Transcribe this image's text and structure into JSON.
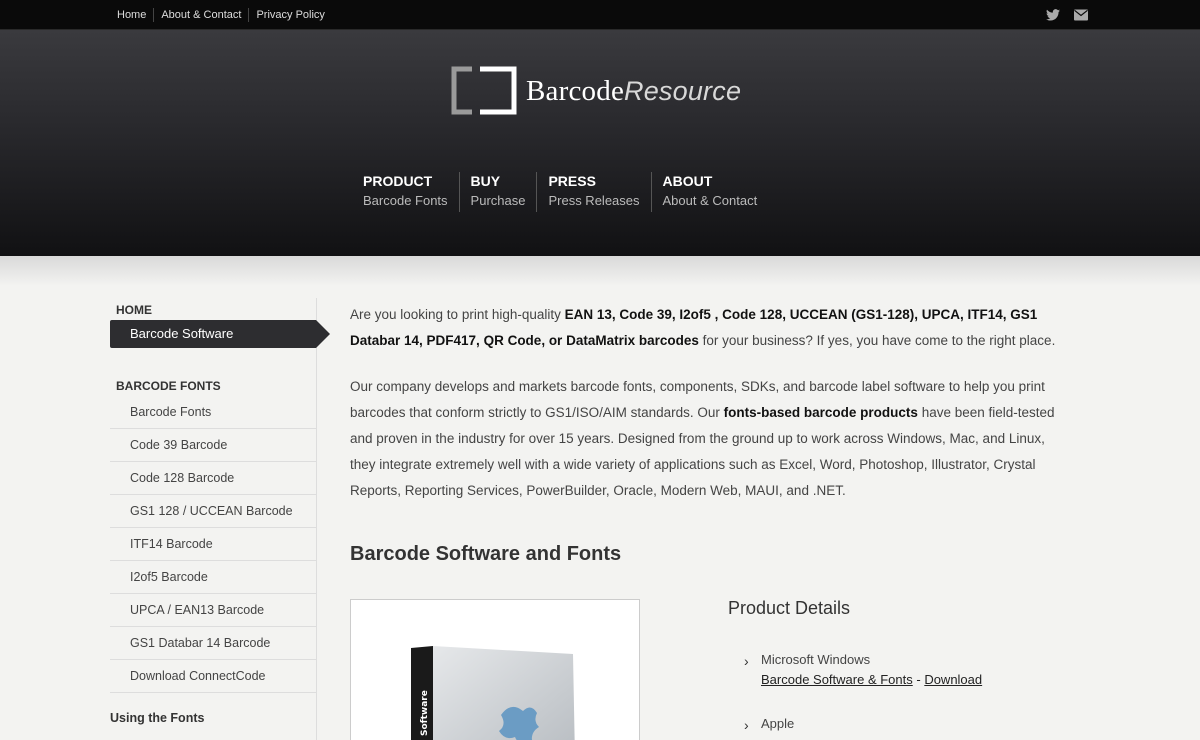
{
  "topnav": [
    "Home",
    "About & Contact",
    "Privacy Policy"
  ],
  "social": [
    "twitter-icon",
    "envelope-icon"
  ],
  "logo": {
    "part1": "Barcode",
    "part2": "Resource"
  },
  "mainnav": [
    {
      "title": "PRODUCT",
      "sub": "Barcode Fonts"
    },
    {
      "title": "BUY",
      "sub": "Purchase"
    },
    {
      "title": "PRESS",
      "sub": "Press Releases"
    },
    {
      "title": "ABOUT",
      "sub": "About & Contact"
    }
  ],
  "sidebar": {
    "home_heading": "HOME",
    "active": "Barcode Software",
    "fonts_heading": "BARCODE FONTS",
    "items": [
      "Barcode Fonts",
      "Code 39 Barcode",
      "Code 128 Barcode",
      "GS1 128 / UCCEAN Barcode",
      "ITF14 Barcode",
      "I2of5 Barcode",
      "UPCA / EAN13 Barcode",
      "GS1 Databar 14 Barcode",
      "Download ConnectCode"
    ],
    "using": "Using the Fonts"
  },
  "intro": {
    "p1_a": "Are you looking to print high-quality ",
    "p1_b": "EAN 13, Code 39, I2of5 , Code 128, UCCEAN (GS1-128), UPCA, ITF14, GS1 Databar 14, PDF417, QR Code, or DataMatrix barcodes",
    "p1_c": " for your business? If yes, you have come to the right place.",
    "p2_a": "Our company develops and markets barcode fonts, components, SDKs, and barcode label software to help you print barcodes that conform strictly to GS1/ISO/AIM standards. Our ",
    "p2_b": "fonts-based barcode products",
    "p2_c": " have been field-tested and proven in the industry for over 15 years. Designed from the ground up to work across Windows, Mac, and Linux, they integrate extremely well with a wide variety of applications such as Excel, Word, Photoshop, Illustrator, Crystal Reports, Reporting Services, PowerBuilder, Oracle, Modern Web, MAUI, and .NET."
  },
  "section_title": "Barcode Software and Fonts",
  "product_box_label": "Software",
  "details": {
    "title": "Product Details",
    "items": [
      {
        "os": "Microsoft Windows",
        "link1": "Barcode Software & Fonts",
        "sep": " - ",
        "link2": "Download"
      },
      {
        "os": "Apple"
      }
    ]
  }
}
